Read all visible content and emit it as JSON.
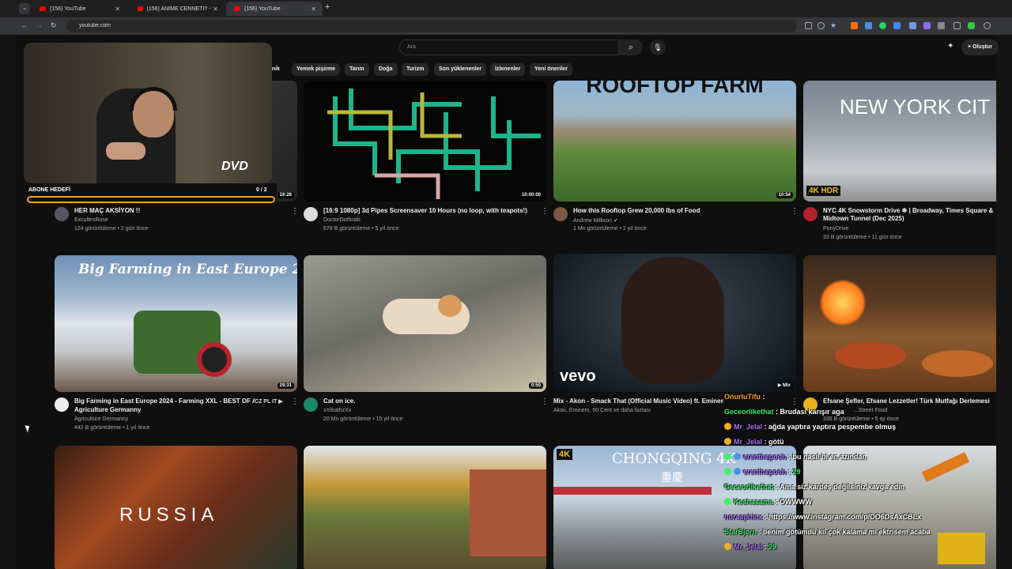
{
  "browser": {
    "tabs": [
      {
        "label": "(156) YouTube",
        "active": false
      },
      {
        "label": "(156) ANİME CENNETİ? - YouTu",
        "active": false
      },
      {
        "label": "(156) YouTube",
        "active": true
      }
    ],
    "url": "youtube.com"
  },
  "header": {
    "search_placeholder": "Ara",
    "create_label": "Oluştur"
  },
  "chips": [
    "...nik",
    "Yemek pişirme",
    "Tarım",
    "Doğa",
    "Turizm",
    "Son yüklenenler",
    "İzlenenler",
    "Yeni öneriler"
  ],
  "webcam": {
    "goal_label": "ABONE HEDEFİ",
    "goal_count": "0 / 2",
    "logo_text": "DVD"
  },
  "videos": [
    {
      "title": "HER MAÇ AKSİYON !!",
      "channel": "ExcultesRose",
      "stats": "124 görüntüleme • 2 gün önce",
      "duration": "16:26"
    },
    {
      "title": "[16:9 1080p] 3d Pipes Screensaver 10 Hours (no loop, with teapots!)",
      "channel": "DoctorDothraki",
      "stats": "678 B görüntüleme • 5 yıl önce",
      "duration": "10:00:00"
    },
    {
      "title": "How this Rooftop Grew 20,000 lbs of Food",
      "channel": "Andrew Millison",
      "stats": "1 Mn görüntüleme • 1 yıl önce",
      "duration": "10:54",
      "overlay": "ROOFTOP FARM"
    },
    {
      "title": "NYC 4K Snowstorm Drive ❄ | Broadway, Times Square & Midtown Tunnel (Dec 2025)",
      "channel": "PonyDrive",
      "stats": "33 B görüntüleme • 11 gün önce",
      "overlay": "NEW YORK CIT",
      "badge": "4K HDR"
    },
    {
      "title": "Big Farming in East Europe 2024 - Farming XXL - BEST OF Agriculture Germanny",
      "title_line2": "Agriculture Germanny",
      "channel": "Agriculture Germanny",
      "stats": "442 B görüntüleme • 1 yıl önce",
      "duration": "29:31",
      "overlay": "Big Farming in East Europe 2024",
      "lang": "CZ PL IT ▶"
    },
    {
      "title": "Cat on ice.",
      "channel": "xXfeathzXx",
      "stats": "20 Mn görüntüleme • 15 yıl önce",
      "duration": "0:50"
    },
    {
      "title": "Mix - Akon - Smack That (Official Music Video) ft. Eminem",
      "channel": "Akon, Eminem, 50 Cent ve daha fazlası",
      "stats": "",
      "overlay": "vevo",
      "mix": "▶ Mix"
    },
    {
      "title": "Efsane Şefler, Efsane Lezzetler! Türk Mutfağı Derlemesi",
      "channel": "...Street Food",
      "stats": "335 B görüntüleme • 5 ay önce"
    },
    {
      "overlay": "RUSSIA"
    },
    {
      "overlay": ""
    },
    {
      "overlay": "CHONGQING 4K",
      "overlay2": "重慶",
      "badge": "4K"
    },
    {
      "overlay": ""
    }
  ],
  "chat": [
    {
      "user": "OnurluTifu",
      "msg": "",
      "color": "#ff9e2c",
      "badge": false
    },
    {
      "user": "Geceorlikethat",
      "msg": "Brudasi karışır aga",
      "color": "#3ef06b",
      "badge": false
    },
    {
      "user": "Mr_Jelal",
      "msg": "ağda yaptıra yaptıra pespembe olmuş",
      "color": "#a970ff",
      "badge": true
    },
    {
      "user": "Mr_Jelal",
      "msg": "götü",
      "color": "#a970ff",
      "badge": true
    },
    {
      "user": "erenthepooh",
      "msg": "bu nasıl bi en azından",
      "color": "#a970ff",
      "badge": true
    },
    {
      "user": "erenthepooh",
      "msg": "29",
      "color": "#a970ff",
      "badge": true
    },
    {
      "user": "Geceorlikethat",
      "msg": "Ama siz kardeş değilsiniz kavga edin",
      "color": "#3ef06b",
      "badge": false
    },
    {
      "user": "Keshasama",
      "msg": "OWWWW",
      "color": "#3ef06b",
      "badge": true
    },
    {
      "user": "norasphinx",
      "msg": "https://www.instagram.com/p/DO6DsAxCBLx",
      "color": "#a970ff",
      "badge": false
    },
    {
      "user": "StarBjorn",
      "msg": "benim götümdü kıl çok kalama mı ektrisem acaba",
      "color": "#3ef06b",
      "badge": false
    },
    {
      "user": "Mr_Jelal",
      "msg": "29",
      "color": "#a970ff",
      "badge": true
    }
  ]
}
